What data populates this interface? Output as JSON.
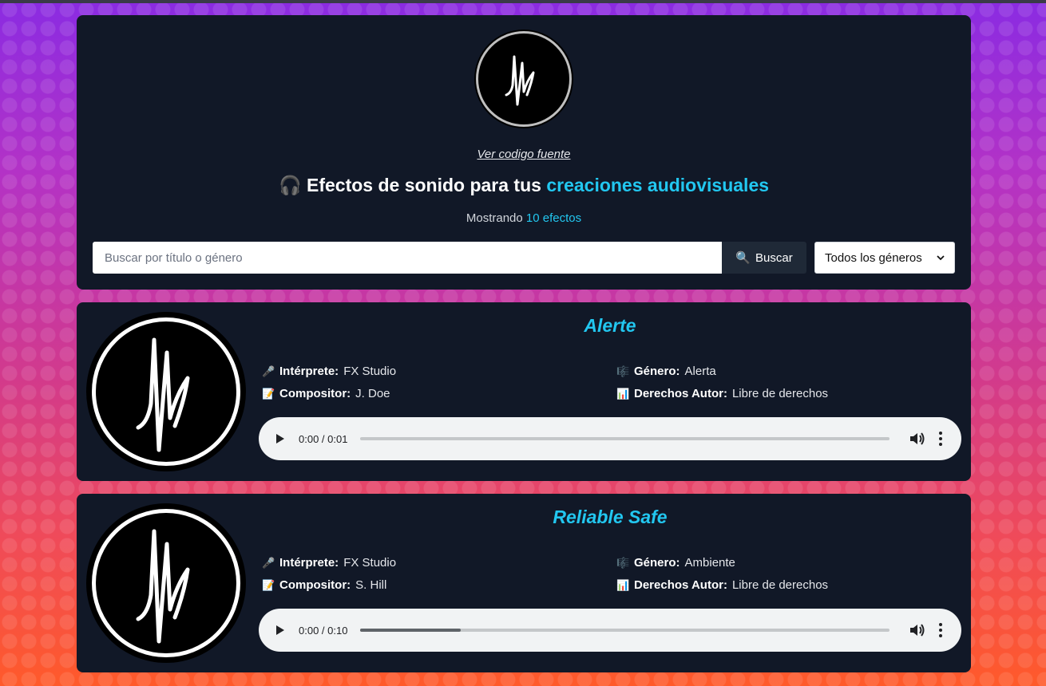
{
  "header": {
    "source_link": "Ver codigo fuente",
    "title_icon": "🎧",
    "title_prefix": "Efectos de sonido para tus",
    "title_accent": "creaciones audiovisuales",
    "count_prefix": "Mostrando",
    "count_value": "10 efectos"
  },
  "search": {
    "placeholder": "Buscar por título o género",
    "value": "",
    "button_icon": "🔍",
    "button_label": "Buscar"
  },
  "genre_filter": {
    "selected": "Todos los géneros"
  },
  "labels": {
    "performer": "Intérprete:",
    "genre": "Género:",
    "composer": "Compositor:",
    "rights": "Derechos Autor:"
  },
  "icons": {
    "performer": "🎤",
    "genre": "🎼",
    "composer": "📝",
    "rights": "📊"
  },
  "effects": [
    {
      "title": "Alerte",
      "performer": "FX Studio",
      "genre": "Alerta",
      "composer": "J. Doe",
      "rights": "Libre de derechos",
      "time": "0:00 / 0:01",
      "progress": 0
    },
    {
      "title": "Reliable Safe",
      "performer": "FX Studio",
      "genre": "Ambiente",
      "composer": "S. Hill",
      "rights": "Libre de derechos",
      "time": "0:00 / 0:10",
      "progress": 0.19
    }
  ],
  "colors": {
    "accent": "#22c7f0",
    "card": "#111827"
  }
}
